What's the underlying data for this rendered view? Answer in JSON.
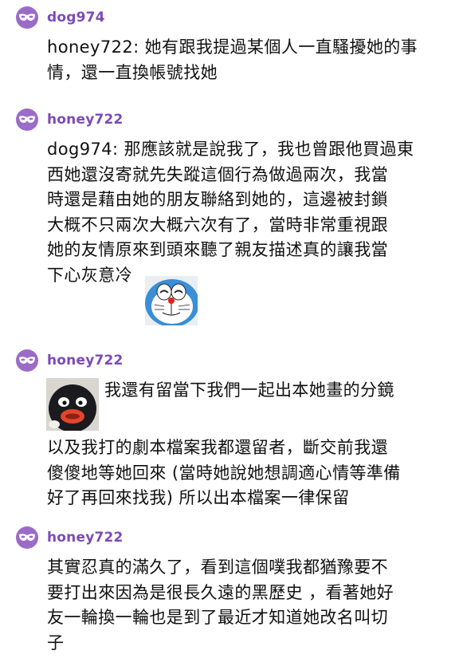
{
  "posts": [
    {
      "username": "dog974",
      "lines": [
        "honey722: 她有跟我提過某個人一直騷擾她的事",
        "情，還一直換帳號找她"
      ]
    },
    {
      "username": "honey722",
      "lines": [
        "dog974: 那應該就是說我了，我也曾跟他買過東",
        "西她還沒寄就先失蹤這個行為做過兩次，我當",
        "時還是藉由她的朋友聯絡到她的，這邊被封鎖",
        "大概不只兩次大概六次有了，當時非常重視跟",
        "她的友情原來到頭來聽了親友描述真的讓我當",
        "下心灰意冷"
      ],
      "sticker": "doraemon-sticker"
    },
    {
      "username": "honey722",
      "sticker": "penguin-sticker",
      "first_line": "我還有留當下我們一起出本她畫的分鏡",
      "lines": [
        "以及我打的劇本檔案我都還留者，斷交前我還",
        "傻傻地等她回來 (當時她說她想調適心情等準備",
        "好了再回來找我) 所以出本檔案一律保留"
      ]
    },
    {
      "username": "honey722",
      "lines": [
        "其實忍真的滿久了，看到這個噗我都猶豫要不",
        "要打出來因為是很長久遠的黑歷史 ，看著她好",
        "友一輪換一輪也是到了最近才知道她改名叫切",
        "子"
      ]
    }
  ],
  "colors": {
    "accent": "#9b6bc8",
    "username": "#7c4ab8"
  },
  "icons": {
    "avatar": "mask-icon"
  }
}
